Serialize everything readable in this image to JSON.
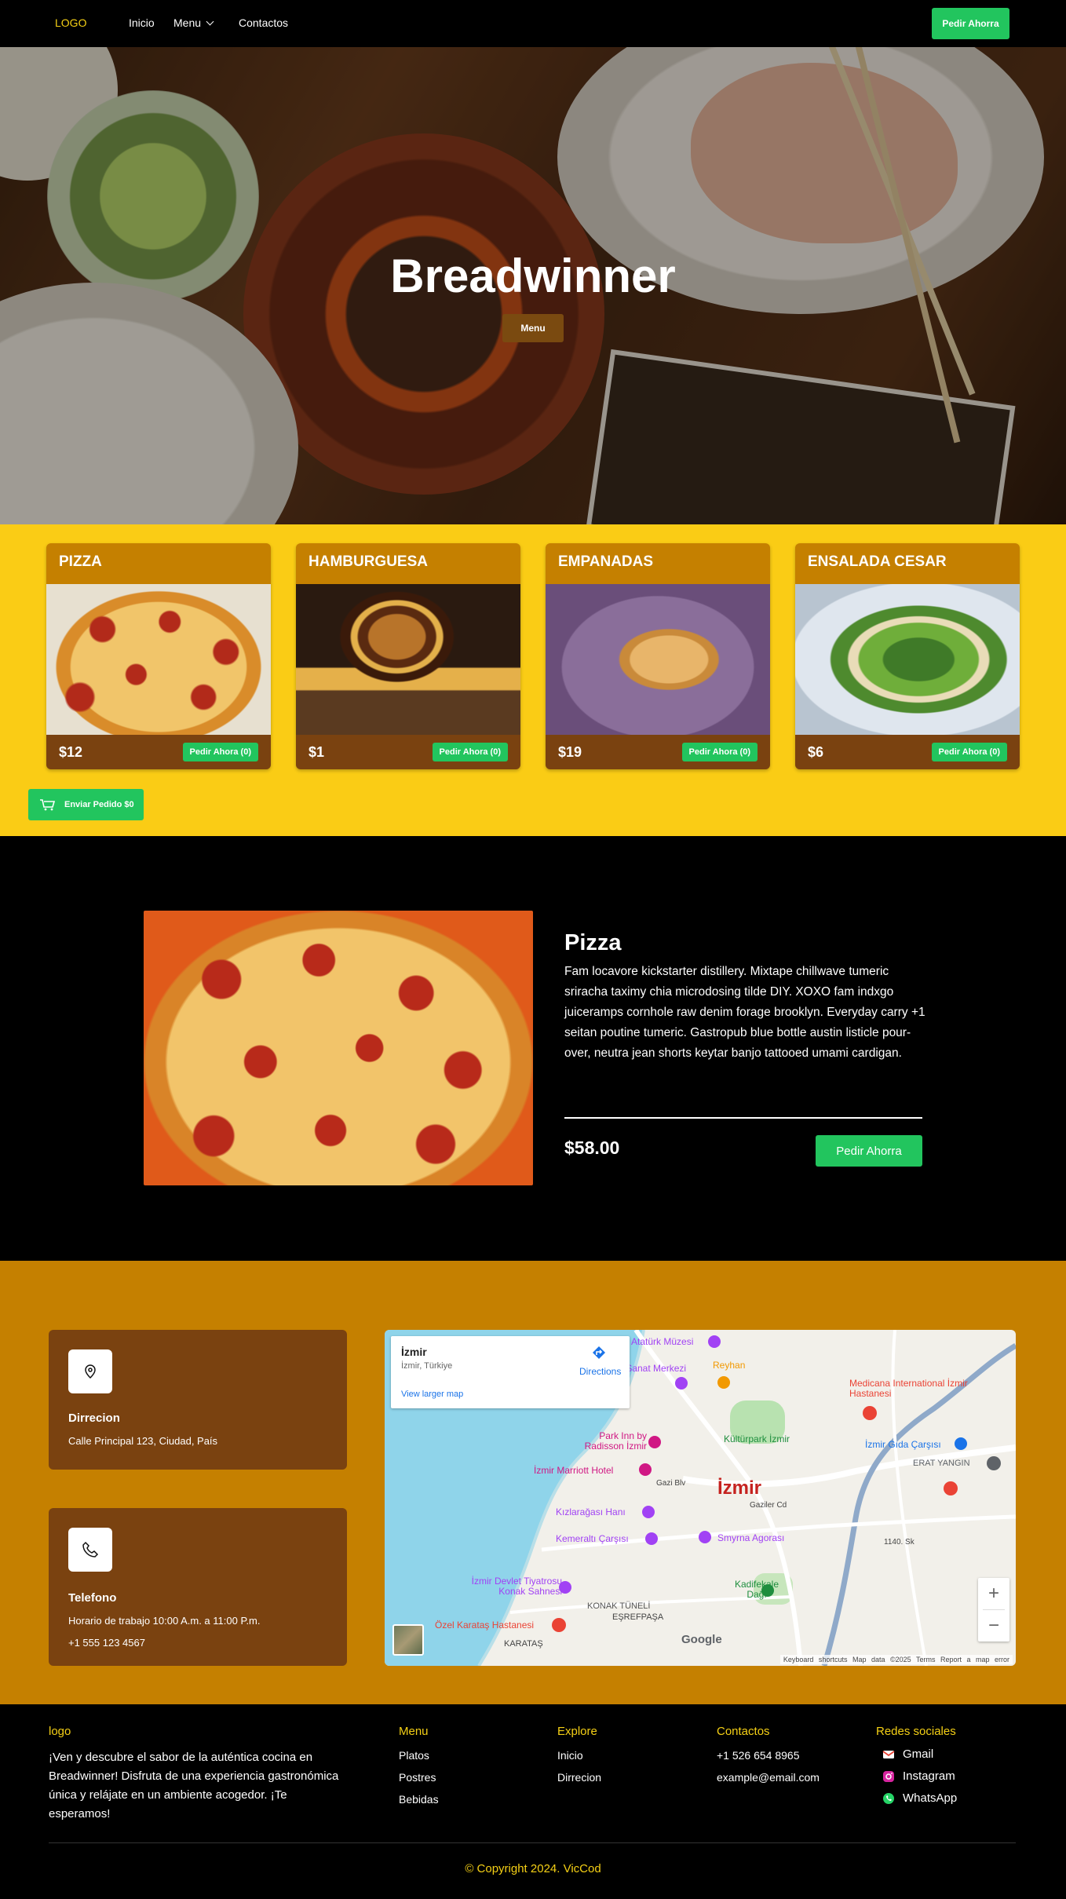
{
  "nav": {
    "logo": "LOGO",
    "links": [
      "Inicio",
      "Menu",
      "Contactos"
    ],
    "cta": "Pedir Ahorra"
  },
  "hero": {
    "title": "Breadwinner",
    "button": "Menu"
  },
  "menu": {
    "items": [
      {
        "name": "PIZZA",
        "price": "$12",
        "order": "Pedir Ahora (0)"
      },
      {
        "name": "HAMBURGUESA",
        "price": "$1",
        "order": "Pedir Ahora (0)"
      },
      {
        "name": "EMPANADAS",
        "price": "$19",
        "order": "Pedir Ahora (0)"
      },
      {
        "name": "ENSALADA CESAR",
        "price": "$6",
        "order": "Pedir Ahora (0)"
      }
    ],
    "send": "Enviar Pedido $0"
  },
  "detail": {
    "title": "Pizza",
    "description": "Fam locavore kickstarter distillery. Mixtape chillwave tumeric sriracha taximy chia microdosing tilde DIY. XOXO fam indxgo juiceramps cornhole raw denim forage brooklyn. Everyday carry +1 seitan poutine tumeric. Gastropub blue bottle austin listicle pour-over, neutra jean shorts keytar banjo tattooed umami cardigan.",
    "price": "$58.00",
    "button": "Pedir Ahorra"
  },
  "contact": {
    "address": {
      "label": "Dirrecion",
      "text": "Calle Principal 123, Ciudad, País"
    },
    "phone": {
      "label": "Telefono",
      "hours": "Horario de trabajo 10:00 A.m. a 11:00 P.m.",
      "number": "+1 555 123 4567"
    }
  },
  "map": {
    "place": "İzmir",
    "region": "İzmir, Türkiye",
    "directions": "Directions",
    "larger": "View larger map",
    "city_label": "İzmir",
    "pois": [
      "Atatürk Müzesi",
      "s Sanat Merkezi",
      "Reyhan",
      "Medicana International İzmir Hastanesi",
      "Park Inn by Radisson İzmir",
      "Kültürpark İzmir",
      "İzmir Gıda Çarşısı",
      "ERAT YANGIN",
      "İzmir Marriott Hotel",
      "Kızlarağası Hanı",
      "Kemeraltı Çarşısı",
      "Smyrna Agorası",
      "İzmir Devlet Tiyatrosu Konak Sahnesi",
      "Kadifekale Dağı",
      "KONAK TÜNELİ",
      "EŞREFPAŞA",
      "Özel Karataş Hastanesi",
      "KARATAŞ",
      "Gazi Blv",
      "Gaziler Cd",
      "1140. Sk"
    ],
    "google": "Google",
    "footer": "Keyboard shortcuts   Map data ©2025   Terms   Report a map error"
  },
  "footer": {
    "logo": "logo",
    "about": "¡Ven y descubre el sabor de la auténtica cocina en Breadwinner! Disfruta de una experiencia gastronómica única y relájate en un ambiente acogedor. ¡Te esperamos!",
    "menu": {
      "title": "Menu",
      "items": [
        "Platos",
        "Postres",
        "Bebidas"
      ]
    },
    "explore": {
      "title": "Explore",
      "items": [
        "Inicio",
        "Dirrecion"
      ]
    },
    "contactos": {
      "title": "Contactos",
      "items": [
        "+1 526 654 8965",
        "example@email.com"
      ]
    },
    "social": {
      "title": "Redes sociales",
      "items": [
        "Gmail",
        "Instagram",
        "WhatsApp"
      ]
    },
    "copyright": "© Copyright 2024. VicCod"
  },
  "colors": {
    "accent_green": "#22c55e",
    "yellow": "#facc15",
    "brand_yellow_text": "#f5d015",
    "orange": "#c58000",
    "brown": "#7a4210"
  }
}
